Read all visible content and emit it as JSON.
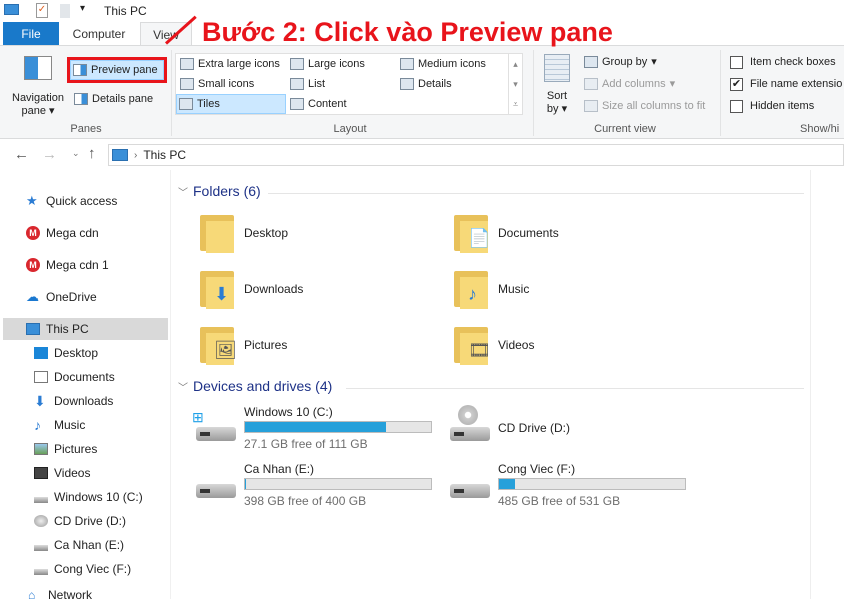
{
  "window": {
    "title": "This PC"
  },
  "tabs": [
    {
      "label": "File"
    },
    {
      "label": "Computer"
    },
    {
      "label": "View"
    }
  ],
  "annotation": {
    "text": "Bước 2: Click vào Preview pane",
    "color": "#e8141b"
  },
  "ribbon": {
    "panes": {
      "label": "Panes",
      "navigation_pane": "Navigation",
      "navigation_pane_2": "pane",
      "preview_pane": "Preview pane",
      "details_pane": "Details pane"
    },
    "layout": {
      "label": "Layout",
      "items": [
        "Extra large icons",
        "Large icons",
        "Medium icons",
        "Small icons",
        "List",
        "Details",
        "Tiles",
        "Content"
      ],
      "selected": "Tiles"
    },
    "current_view": {
      "label": "Current view",
      "sort_by": "Sort",
      "sort_by_2": "by",
      "group_by": "Group by",
      "add_columns": "Add columns",
      "size_columns": "Size all columns to fit"
    },
    "show_hide": {
      "label": "Show/hi",
      "item_check_boxes": "Item check boxes",
      "file_name_extensions": "File name extensio",
      "hidden_items": "Hidden items",
      "checked": {
        "item_check_boxes": false,
        "file_name_extensions": true,
        "hidden_items": false
      }
    }
  },
  "address": {
    "location": "This PC"
  },
  "nav": {
    "items": [
      {
        "label": "Quick access",
        "icon": "star-icon"
      },
      {
        "label": "Mega cdn",
        "icon": "mega-icon"
      },
      {
        "label": "Mega cdn 1",
        "icon": "mega-icon"
      },
      {
        "label": "OneDrive",
        "icon": "cloud-icon"
      },
      {
        "label": "This PC",
        "icon": "computer-icon",
        "selected": true
      },
      {
        "label": "Desktop",
        "icon": "desktop-icon"
      },
      {
        "label": "Documents",
        "icon": "documents-icon"
      },
      {
        "label": "Downloads",
        "icon": "downloads-icon"
      },
      {
        "label": "Music",
        "icon": "music-icon"
      },
      {
        "label": "Pictures",
        "icon": "pictures-icon"
      },
      {
        "label": "Videos",
        "icon": "videos-icon"
      },
      {
        "label": "Windows 10 (C:)",
        "icon": "drive-icon"
      },
      {
        "label": "CD Drive (D:)",
        "icon": "cd-drive-icon"
      },
      {
        "label": "Ca Nhan (E:)",
        "icon": "drive-icon"
      },
      {
        "label": "Cong Viec (F:)",
        "icon": "drive-icon"
      },
      {
        "label": "Network",
        "icon": "network-icon"
      }
    ]
  },
  "content": {
    "folders_header": "Folders (6)",
    "folders": [
      {
        "name": "Desktop"
      },
      {
        "name": "Documents"
      },
      {
        "name": "Downloads"
      },
      {
        "name": "Music"
      },
      {
        "name": "Pictures"
      },
      {
        "name": "Videos"
      }
    ],
    "drives_header": "Devices and drives (4)",
    "drives": [
      {
        "name": "Windows 10 (C:)",
        "free": "27.1 GB free of 111 GB",
        "used_fraction": 0.756
      },
      {
        "name": "CD Drive (D:)"
      },
      {
        "name": "Ca Nhan (E:)",
        "free": "398 GB free of 400 GB",
        "used_fraction": 0.005
      },
      {
        "name": "Cong Viec (F:)",
        "free": "485 GB free of 531 GB",
        "used_fraction": 0.087
      }
    ]
  },
  "colors": {
    "accent": "#1979ca",
    "selection": "#cce8ff",
    "bar": "#26a0da"
  }
}
